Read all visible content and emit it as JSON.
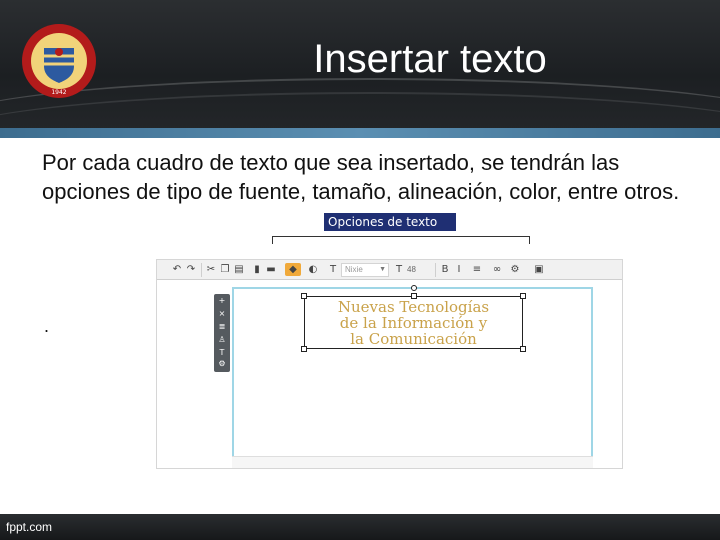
{
  "slide": {
    "title": "Insertar texto",
    "body": "Por cada cuadro de texto que sea insertado, se tendrán las opciones de tipo de fuente, tamaño, alineación, color, entre otros.",
    "dot": ".",
    "callout": "Opciones de texto"
  },
  "logo": {
    "icon": "university-seal-icon",
    "text": "UNIVERSIDAD DE SONORA",
    "year": "1942"
  },
  "editor": {
    "font_name": "Nixie",
    "font_size": "48",
    "toolbar_icons": [
      "undo-icon",
      "redo-icon",
      "cut-icon",
      "copy-icon",
      "paste-icon",
      "lock-icon",
      "delete-icon",
      "fill-color-icon",
      "border-icon",
      "text-icon",
      "bold-icon",
      "italic-icon",
      "align-icon",
      "link-icon",
      "more-icon",
      "layer-icon"
    ],
    "side_tools": [
      "add-icon",
      "close-icon",
      "list-icon",
      "person-icon",
      "text-icon",
      "gear-icon"
    ],
    "textbox_lines": [
      "Nuevas Tecnologías",
      "de la Información y",
      "la Comunicación"
    ]
  },
  "footer": {
    "site": "fppt.com"
  },
  "colors": {
    "header": "#1f2225",
    "accent_blue": "#4f83a8",
    "callout": "#1f2f73",
    "textbox_text": "#c9a24a"
  }
}
